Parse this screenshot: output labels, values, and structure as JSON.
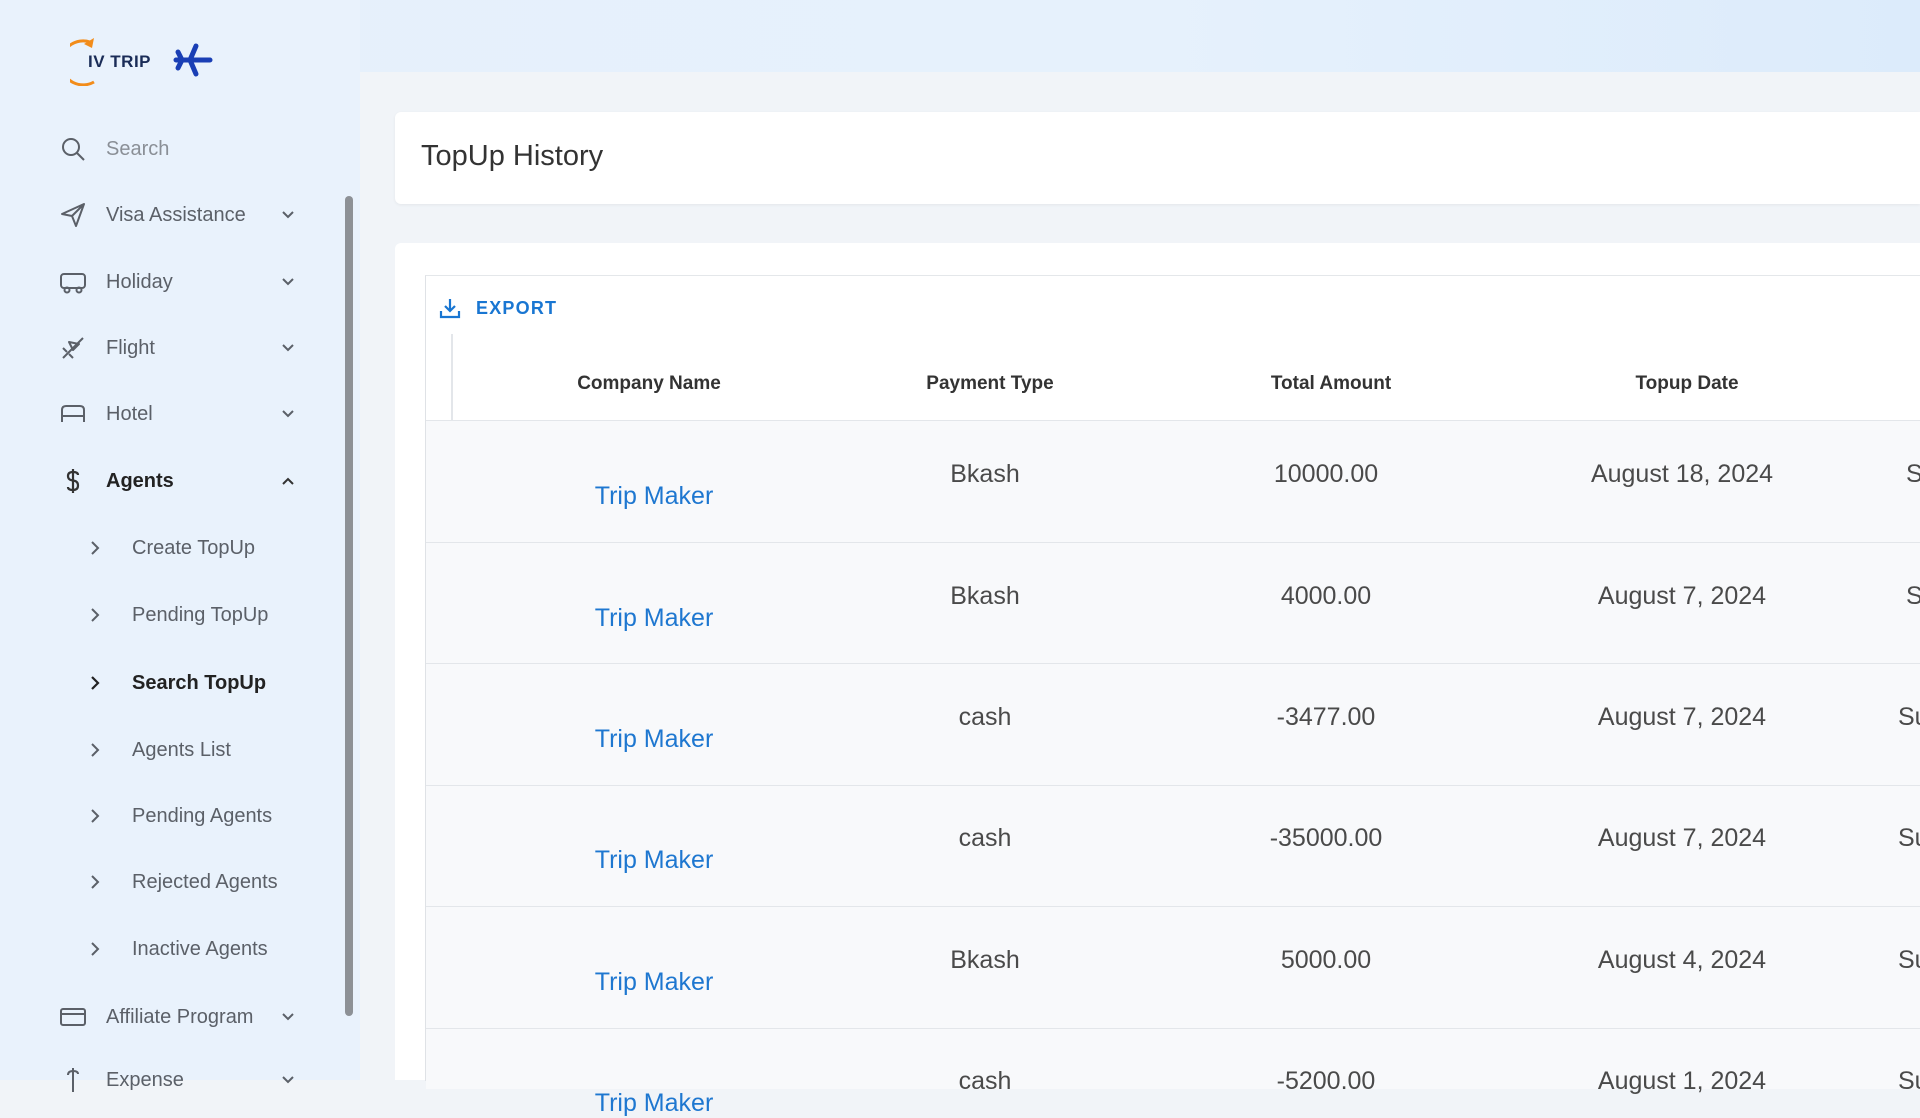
{
  "app": {
    "logo_text": "IV TRIP"
  },
  "sidebar": {
    "search_placeholder": "Search",
    "items": [
      {
        "label": "Visa Assistance",
        "icon": "send-icon",
        "expanded": false
      },
      {
        "label": "Holiday",
        "icon": "bus-icon",
        "expanded": false
      },
      {
        "label": "Flight",
        "icon": "plane-icon",
        "expanded": false
      },
      {
        "label": "Hotel",
        "icon": "bed-icon",
        "expanded": false
      },
      {
        "label": "Agents",
        "icon": "dollar-icon",
        "expanded": true
      }
    ],
    "agents_submenu": [
      {
        "label": "Create TopUp"
      },
      {
        "label": "Pending TopUp"
      },
      {
        "label": "Search TopUp",
        "active": true
      },
      {
        "label": "Agents List"
      },
      {
        "label": "Pending Agents"
      },
      {
        "label": "Rejected Agents"
      },
      {
        "label": "Inactive Agents"
      }
    ],
    "affiliate": {
      "label": "Affiliate Program",
      "icon": "card-icon"
    },
    "next_partial": {
      "label": "Expense"
    }
  },
  "page": {
    "title": "TopUp History"
  },
  "toolbar": {
    "export_label": "EXPORT"
  },
  "table": {
    "columns": [
      "Company Name",
      "Payment Type",
      "Total Amount",
      "Topup Date"
    ],
    "rows": [
      {
        "company": "Trip Maker",
        "payment": "Bkash",
        "amount": "10000.00",
        "date": "August 18, 2024",
        "status_clip": "S"
      },
      {
        "company": "Trip Maker",
        "payment": "Bkash",
        "amount": "4000.00",
        "date": "August 7, 2024",
        "status_clip": "S"
      },
      {
        "company": "Trip Maker",
        "payment": "cash",
        "amount": "-3477.00",
        "date": "August 7, 2024",
        "status_clip": "Su"
      },
      {
        "company": "Trip Maker",
        "payment": "cash",
        "amount": "-35000.00",
        "date": "August 7, 2024",
        "status_clip": "Su"
      },
      {
        "company": "Trip Maker",
        "payment": "Bkash",
        "amount": "5000.00",
        "date": "August 4, 2024",
        "status_clip": "Su"
      },
      {
        "company": "Trip Maker",
        "payment": "cash",
        "amount": "-5200.00",
        "date": "August 1, 2024",
        "status_clip": "Su"
      }
    ]
  },
  "colors": {
    "accent": "#1976d2",
    "link": "#1e77d0",
    "sidebar_bg": "#e9f2fc"
  }
}
